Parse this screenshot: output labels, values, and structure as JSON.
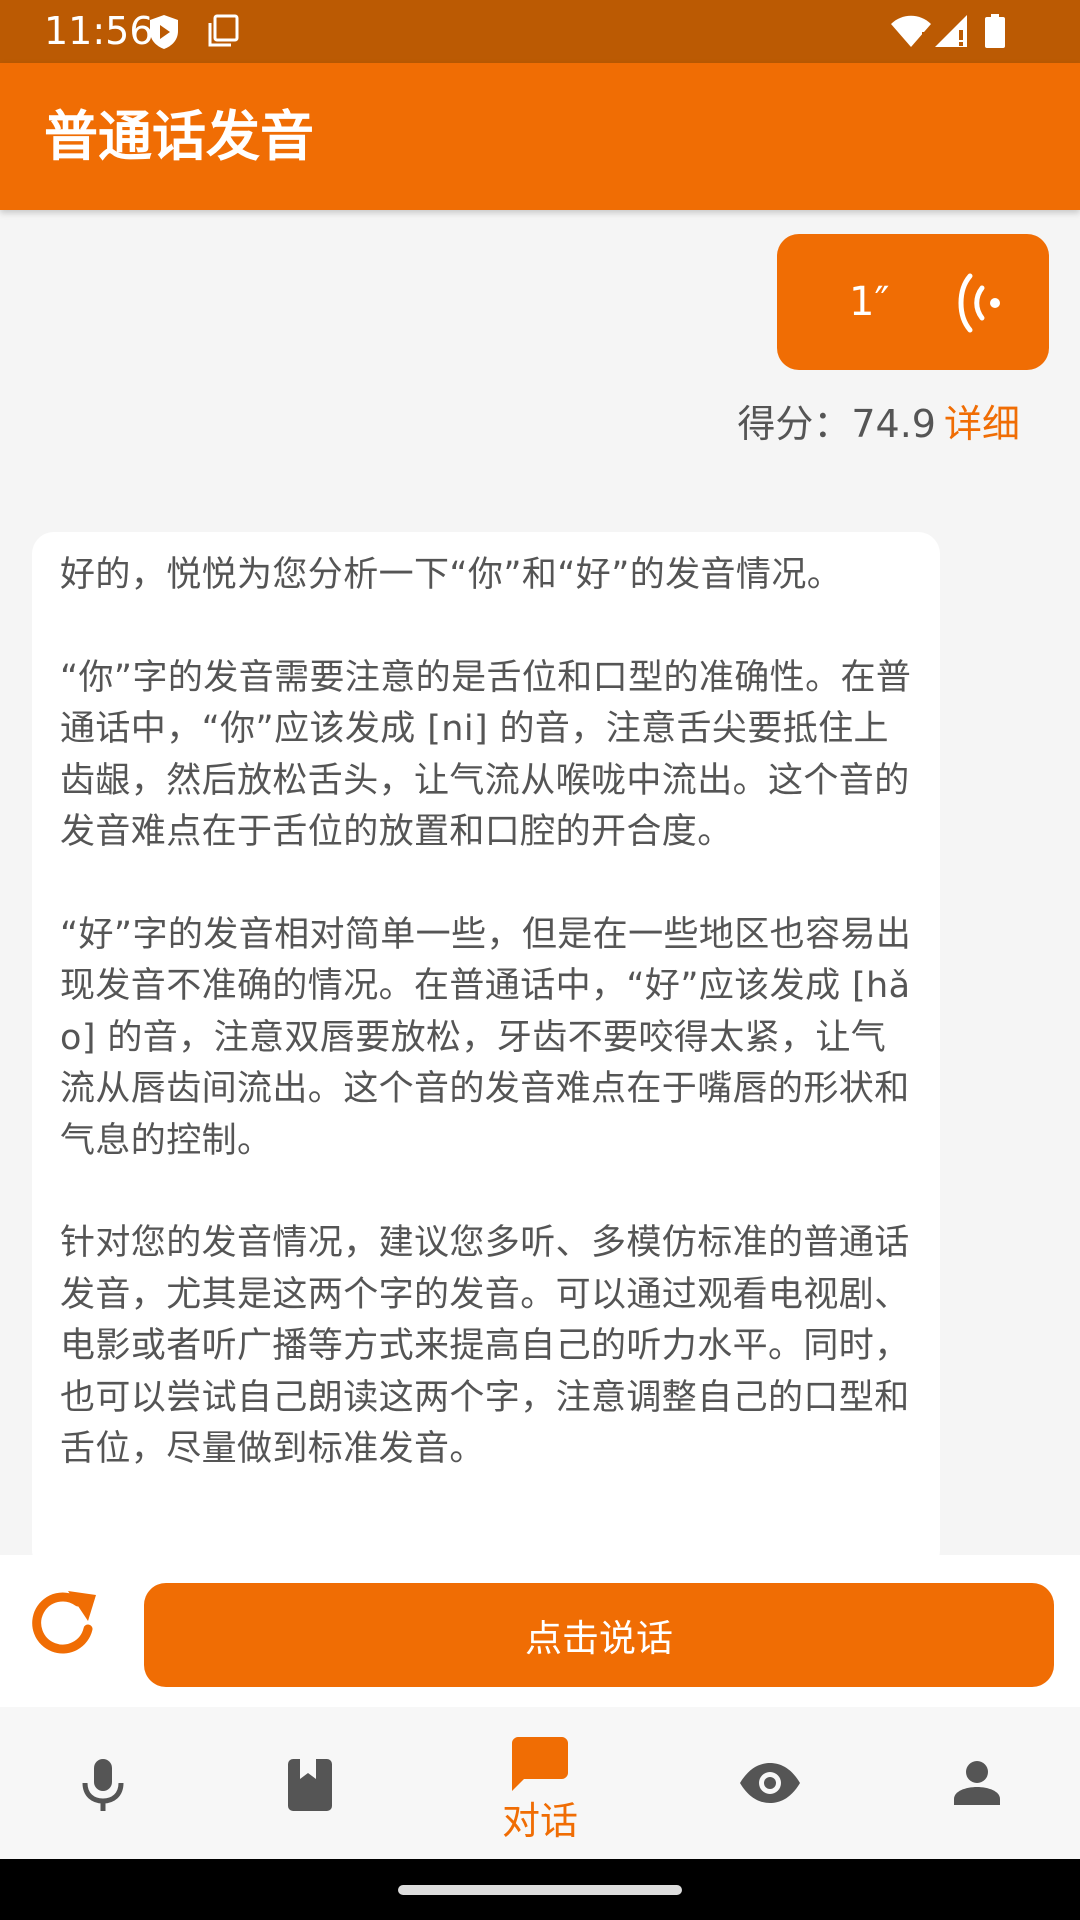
{
  "status_bar": {
    "time": "11:56",
    "icons": [
      "shield-play-icon",
      "copy-icon",
      "wifi-icon",
      "signal-icon",
      "battery-icon"
    ]
  },
  "app_bar": {
    "title": "普通话发音"
  },
  "chat": {
    "voice_message": {
      "duration": "1″",
      "icon": "sound-wave-icon"
    },
    "score": {
      "label": "得分：74.9",
      "detail_link": "详细"
    },
    "reply": {
      "paragraphs": [
        "好的，悦悦为您分析一下“你”和“好”的发音情况。",
        "“你”字的发音需要注意的是舌位和口型的准确性。在普通话中，“你”应该发成 [ni] 的音，注意舌尖要抵住上齿龈，然后放松舌头，让气流从喉咙中流出。这个音的发音难点在于舌位的放置和口腔的开合度。",
        "“好”字的发音相对简单一些，但是在一些地区也容易出现发音不准确的情况。在普通话中，“好”应该发成 [hǎo] 的音，注意双唇要放松，牙齿不要咬得太紧，让气流从唇齿间流出。这个音的发音难点在于嘴唇的形状和气息的控制。",
        "针对您的发音情况，建议您多听、多模仿标准的普通话发音，尤其是这两个字的发音。可以通过观看电视剧、电影或者听广播等方式来提高自己的听力水平。同时，也可以尝试自己朗读这两个字，注意调整自己的口型和舌位，尽量做到标准发音。"
      ]
    }
  },
  "input_row": {
    "refresh_icon": "refresh-icon",
    "talk_button": "点击说话"
  },
  "bottom_nav": {
    "items": [
      {
        "icon": "microphone-icon",
        "label": ""
      },
      {
        "icon": "book-icon",
        "label": ""
      },
      {
        "icon": "chat-icon",
        "label": "对话",
        "active": true
      },
      {
        "icon": "eye-icon",
        "label": ""
      },
      {
        "icon": "person-icon",
        "label": ""
      }
    ]
  },
  "colors": {
    "status_bar": "#bb5a03",
    "primary": "#f06d04",
    "background": "#f5f5f5",
    "nav_icon": "#555555"
  }
}
